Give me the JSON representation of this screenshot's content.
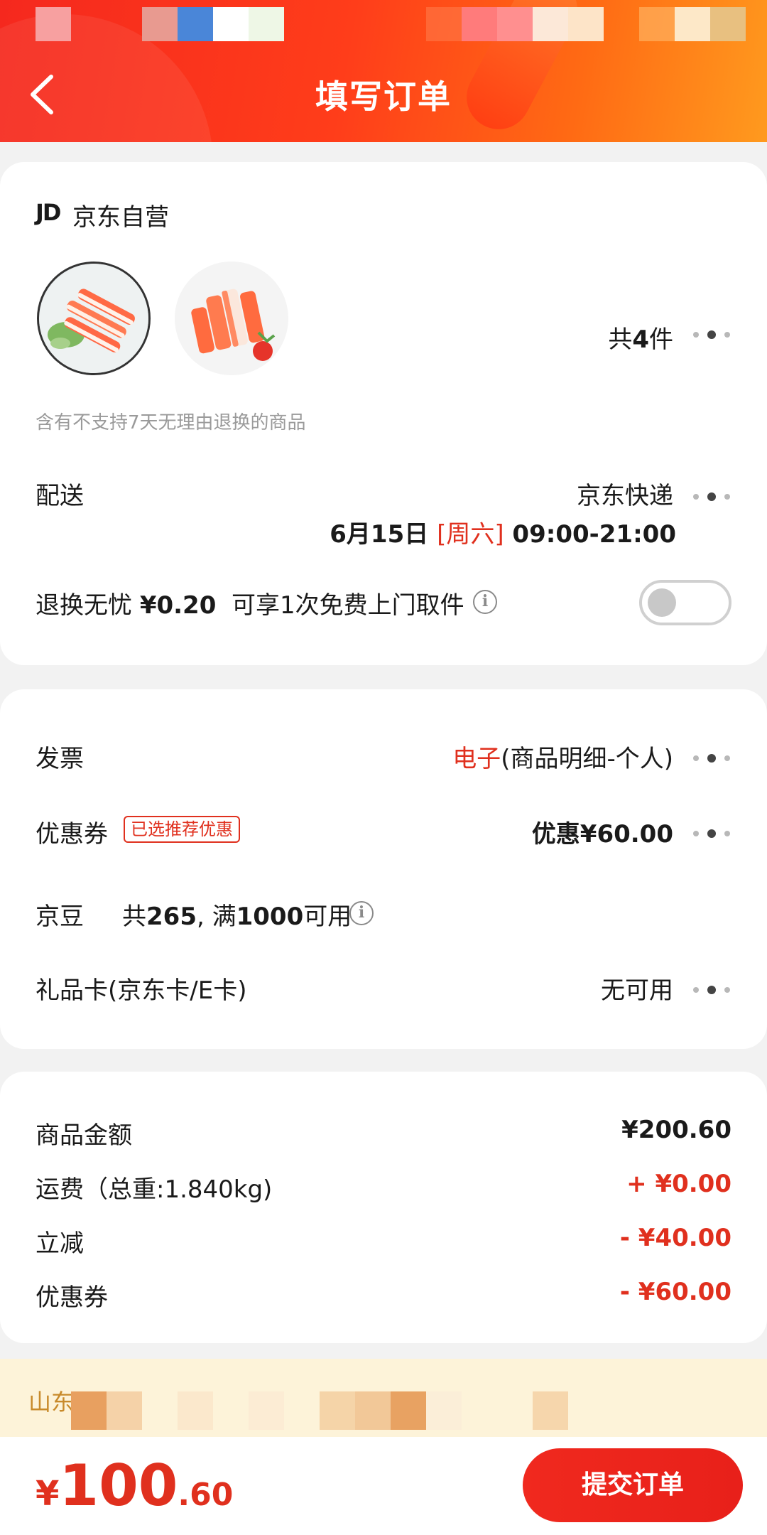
{
  "header": {
    "title": "填写订单",
    "back_icon": "chevron-left-icon"
  },
  "store": {
    "logo": "JD",
    "name": "京东自营"
  },
  "products": {
    "count_prefix": "共",
    "count_num": "4",
    "count_suffix": "件",
    "images": [
      "crab-stick-plate-image",
      "crab-stick-pile-image"
    ]
  },
  "notice": "含有不支持7天无理由退换的商品",
  "delivery": {
    "label": "配送",
    "carrier": "京东快递",
    "date": "6月15日 ",
    "weekday": "[周六]",
    "time": " 09:00-21:00"
  },
  "return_service": {
    "prefix": "退换无忧 ",
    "price": "¥0.20",
    "suffix": "  可享1次免费上门取件",
    "enabled": false
  },
  "invoice": {
    "label": "发票",
    "type": "电子",
    "detail": "(商品明细-个人)"
  },
  "coupon": {
    "label": "优惠券",
    "badge": "已选推荐优惠",
    "value": "优惠¥60.00"
  },
  "beans": {
    "label": "京豆",
    "text_prefix": "共",
    "count": "265",
    "text_mid": ", 满",
    "threshold": "1000",
    "text_suffix": "可用"
  },
  "giftcard": {
    "label": "礼品卡(京东卡/E卡)",
    "value": "无可用"
  },
  "summary": [
    {
      "label": "商品金额",
      "value": "¥200.60",
      "color": "#1a1a1a"
    },
    {
      "label": "运费（总重:1.840kg)",
      "value": "+ ¥0.00",
      "color": "#e0301e"
    },
    {
      "label": "立减",
      "value": "- ¥40.00",
      "color": "#e0301e"
    },
    {
      "label": "优惠券",
      "value": "- ¥60.00",
      "color": "#e0301e"
    }
  ],
  "address": {
    "text": "山东"
  },
  "total": {
    "currency": "¥",
    "integer": "100",
    "decimal": ".60"
  },
  "submit": {
    "label": "提交订单"
  },
  "colors": {
    "brand_red": "#e0301e",
    "header_start": "#f5281e",
    "header_end": "#ff9a1e",
    "address_bg": "#fdf3d9"
  }
}
